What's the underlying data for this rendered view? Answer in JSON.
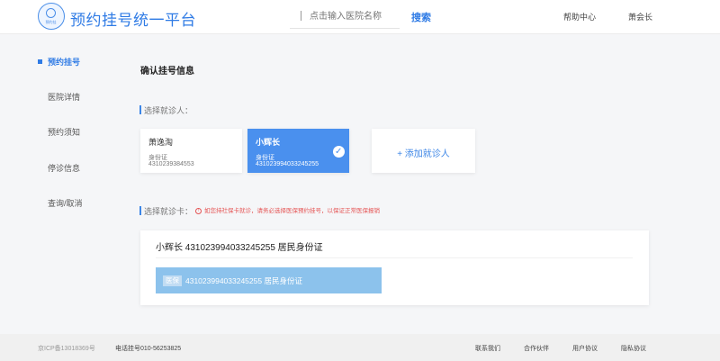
{
  "header": {
    "logo_text": "预约挂",
    "title": "预约挂号统一平台",
    "search_placeholder": "点击输入医院名称",
    "search_button": "搜索",
    "help": "帮助中心",
    "user": "萧会长"
  },
  "sidebar": {
    "items": [
      {
        "label": "预约挂号",
        "active": true
      },
      {
        "label": "医院详情"
      },
      {
        "label": "预约须知"
      },
      {
        "label": "停诊信息"
      },
      {
        "label": "查询/取消"
      }
    ]
  },
  "main": {
    "title": "确认挂号信息",
    "patient_section_label": "选择就诊人：",
    "patients": [
      {
        "name": "萧逸淘",
        "id_type": "身份证",
        "id_number": "4310239384553"
      },
      {
        "name": "小辉长",
        "id_type": "身份证",
        "id_number": "431023994033245255",
        "selected": true
      }
    ],
    "add_patient": "+ 添加就诊人",
    "card_section_label": "选择就诊卡：",
    "warning": "如您持社保卡就诊，请务必选择医保预约挂号，以保证正常医保报销",
    "card_info": "小辉长 431023994033245255 居民身份证",
    "card_badge": "医保",
    "card_text": "431023994033245255  居民身份证"
  },
  "footer": {
    "icp": "京ICP备13018369号",
    "phone": "电话挂号010-56253825",
    "links": [
      "联系我们",
      "合作伙伴",
      "用户协议",
      "隐私协议"
    ]
  },
  "colors": {
    "brand": "#2f7be5",
    "selected_card": "#4a90ee",
    "insurance_card": "#8cc2ec",
    "warning": "#e55454"
  }
}
